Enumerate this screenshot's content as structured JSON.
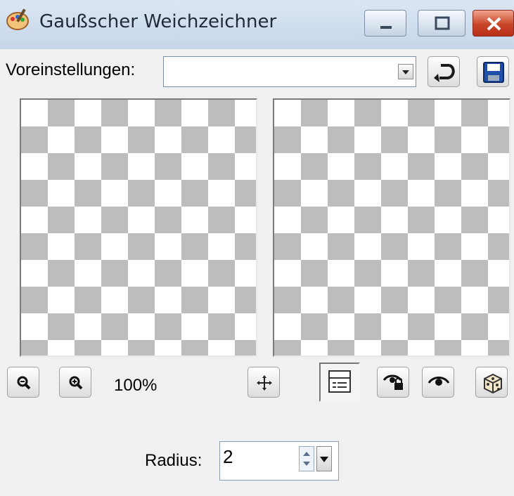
{
  "window": {
    "title": "Gaußscher Weichzeichner",
    "icon": "paint-palette-icon"
  },
  "presets": {
    "label": "Voreinstellungen:",
    "value": "",
    "reset_icon": "reset-arrow-icon",
    "save_icon": "save-disk-icon"
  },
  "zoom": {
    "level": "100%"
  },
  "toolbar": {
    "zoom_out_icon": "zoom-out-icon",
    "zoom_in_icon": "zoom-in-icon",
    "pan_icon": "move-crosshair-icon",
    "proof_icon": "preview-panel-icon",
    "auto_proof_icon": "eye-lock-icon",
    "proof_eye_icon": "eye-icon",
    "random_icon": "dice-icon"
  },
  "radius": {
    "label": "Radius:",
    "value": "2"
  },
  "colors": {
    "close_button": "#c9452a",
    "title_bar": "#c6d6ea",
    "checker": "#bdbdbd"
  }
}
